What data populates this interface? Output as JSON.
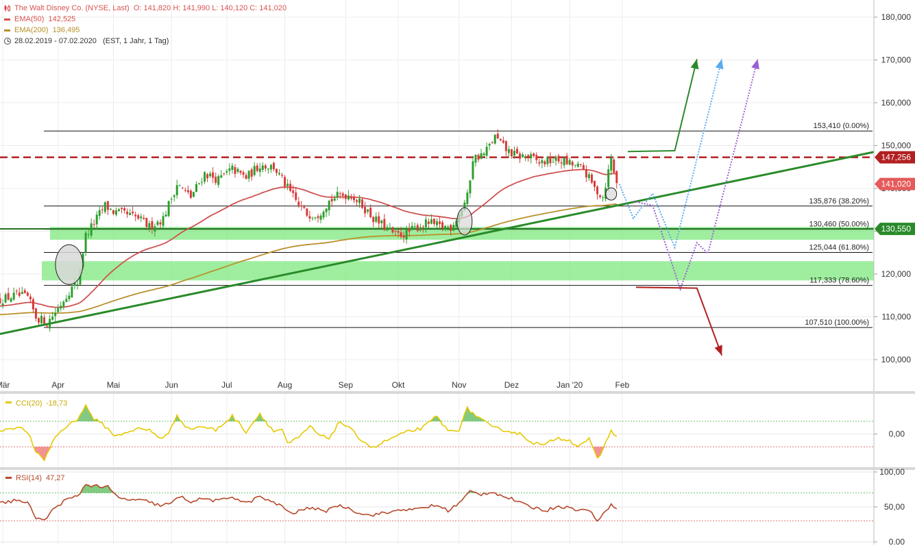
{
  "header": {
    "title": "The Walt Disney Co. (NYSE, Last)",
    "ohlc": "O: 141,820  H: 141,990  L: 140,120  C: 141,020",
    "ema50_label": "EMA(50)",
    "ema50_value": "142,525",
    "ema200_label": "EMA(200)",
    "ema200_value": "136,495",
    "date_range": "28.02.2019 - 07.02.2020",
    "range_info": "(EST, 1 Jahr, 1 Tag)"
  },
  "colors": {
    "up": "#2e9e2e",
    "down": "#d93a3a",
    "ema50": "#d05050",
    "ema200": "#b8902a",
    "trend": "#2a8a2a",
    "resistance": "#b22020",
    "zone": "#7fe87f",
    "cci": "#e6c800",
    "rsi": "#b5482a"
  },
  "chart_data": [
    {
      "type": "candlestick",
      "title": "The Walt Disney Co. (NYSE, Last)",
      "ylim": [
        96000,
        184000
      ],
      "y_ticks": [
        "180,000",
        "170,000",
        "160,000",
        "150,000",
        "140,000",
        "130,000",
        "120,000",
        "110,000",
        "100,000"
      ],
      "y_tick_values": [
        180000,
        170000,
        160000,
        150000,
        140000,
        130000,
        120000,
        110000,
        100000
      ],
      "x_ticks": [
        "Mär",
        "Apr",
        "Mai",
        "Jun",
        "Jul",
        "Aug",
        "Sep",
        "Okt",
        "Nov",
        "Dez",
        "Jan '20",
        "Feb"
      ],
      "x_tick_days": [
        3,
        23,
        43,
        64,
        84,
        105,
        127,
        146,
        168,
        187,
        208,
        227
      ],
      "day_range": [
        2,
        318
      ],
      "anchors": [
        [
          2,
          114
        ],
        [
          8,
          115
        ],
        [
          12,
          114.5
        ],
        [
          15,
          110
        ],
        [
          19,
          108.5
        ],
        [
          23,
          112
        ],
        [
          27,
          116
        ],
        [
          30,
          118
        ],
        [
          33,
          129
        ],
        [
          36,
          132
        ],
        [
          40,
          136
        ],
        [
          43,
          134.5
        ],
        [
          47,
          134
        ],
        [
          52,
          133
        ],
        [
          56,
          131
        ],
        [
          61,
          133
        ],
        [
          66,
          141
        ],
        [
          71,
          138
        ],
        [
          76,
          143.5
        ],
        [
          81,
          142
        ],
        [
          86,
          144.5
        ],
        [
          91,
          142.5
        ],
        [
          96,
          145.5
        ],
        [
          101,
          145
        ],
        [
          106,
          140
        ],
        [
          110,
          136
        ],
        [
          113,
          134
        ],
        [
          117,
          134
        ],
        [
          121,
          137
        ],
        [
          125,
          138.5
        ],
        [
          129,
          138.5
        ],
        [
          133,
          136
        ],
        [
          137,
          133
        ],
        [
          141,
          131
        ],
        [
          145,
          129
        ],
        [
          149,
          129.5
        ],
        [
          153,
          131
        ],
        [
          157,
          132
        ],
        [
          161,
          131
        ],
        [
          165,
          131
        ],
        [
          168,
          134
        ],
        [
          171,
          138
        ],
        [
          173,
          147
        ],
        [
          177,
          148
        ],
        [
          181,
          152
        ],
        [
          185,
          149
        ],
        [
          189,
          147.5
        ],
        [
          193,
          147.5
        ],
        [
          197,
          146
        ],
        [
          201,
          146.5
        ],
        [
          205,
          146.5
        ],
        [
          209,
          145.5
        ],
        [
          213,
          144.5
        ],
        [
          217,
          140
        ],
        [
          220,
          138
        ],
        [
          223,
          147
        ],
        [
          225,
          141
        ]
      ],
      "series": [
        {
          "name": "EMA(50)",
          "last": "142,525"
        },
        {
          "name": "EMA(200)",
          "last": "136,495"
        }
      ],
      "price_tags": [
        {
          "label": "147,256",
          "value": 147256,
          "color": "#b22020",
          "kind": "filled"
        },
        {
          "label": "141,020",
          "value": 141020,
          "color": "#e55a5a",
          "kind": "filled"
        },
        {
          "label": "130,550",
          "value": 130550,
          "color": "#2a8a2a",
          "kind": "filled"
        }
      ],
      "fib_levels": [
        {
          "label": "153,410 (0.00%)",
          "value": 153410
        },
        {
          "label": "135,876 (38.20%)",
          "value": 135876
        },
        {
          "label": "130,460 (50.00%)",
          "value": 130460
        },
        {
          "label": "125,044 (61.80%)",
          "value": 125044
        },
        {
          "label": "117,333 (78.60%)",
          "value": 117333
        },
        {
          "label": "107,510 (100.00%)",
          "value": 107510
        }
      ],
      "resistance": 147256,
      "support_line": 130550,
      "zones": [
        [
          128000,
          131000
        ],
        [
          118500,
          123000
        ]
      ],
      "trendline": [
        [
          2,
          106000
        ],
        [
          318,
          148500
        ]
      ],
      "scenarios": [
        {
          "style": "solid",
          "color": "#2a8a2a",
          "points": [
            [
              229,
              148600
            ],
            [
              246,
              148800
            ],
            [
              254,
              170200
            ]
          ]
        },
        {
          "style": "dotted",
          "color": "#5aaaf0",
          "points": [
            [
              226,
              141000
            ],
            [
              231,
              133000
            ],
            [
              238,
              138800
            ],
            [
              246,
              126200
            ],
            [
              263,
              170200
            ]
          ]
        },
        {
          "style": "dotted",
          "color": "#9a60d0",
          "points": [
            [
              231,
              137000
            ],
            [
              238,
              136000
            ],
            [
              248,
              116500
            ],
            [
              254,
              127300
            ],
            [
              258,
              124800
            ],
            [
              276,
              170200
            ]
          ]
        },
        {
          "style": "solid",
          "color": "#b22020",
          "points": [
            [
              232,
              116900
            ],
            [
              254,
              116700
            ],
            [
              263,
              101000
            ]
          ]
        }
      ]
    },
    {
      "type": "line",
      "title": "CCI(20)",
      "last": "-18,73",
      "ylim": [
        -260,
        310
      ],
      "y_ticks": [
        "0,00"
      ],
      "y_tick_values": [
        0
      ],
      "upper": 100,
      "lower": -100,
      "anchors": [
        [
          2,
          30
        ],
        [
          8,
          55
        ],
        [
          12,
          20
        ],
        [
          15,
          -150
        ],
        [
          18,
          -200
        ],
        [
          22,
          -20
        ],
        [
          26,
          60
        ],
        [
          30,
          120
        ],
        [
          33,
          220
        ],
        [
          36,
          120
        ],
        [
          40,
          60
        ],
        [
          44,
          -20
        ],
        [
          48,
          20
        ],
        [
          52,
          40
        ],
        [
          56,
          30
        ],
        [
          60,
          -30
        ],
        [
          63,
          0
        ],
        [
          66,
          150
        ],
        [
          70,
          40
        ],
        [
          75,
          60
        ],
        [
          80,
          30
        ],
        [
          86,
          140
        ],
        [
          91,
          20
        ],
        [
          96,
          160
        ],
        [
          101,
          20
        ],
        [
          104,
          40
        ],
        [
          106,
          -80
        ],
        [
          110,
          -30
        ],
        [
          114,
          60
        ],
        [
          118,
          -20
        ],
        [
          121,
          -30
        ],
        [
          125,
          100
        ],
        [
          129,
          30
        ],
        [
          133,
          -50
        ],
        [
          137,
          -110
        ],
        [
          141,
          -60
        ],
        [
          145,
          -20
        ],
        [
          150,
          20
        ],
        [
          155,
          50
        ],
        [
          160,
          140
        ],
        [
          164,
          20
        ],
        [
          168,
          40
        ],
        [
          171,
          200
        ],
        [
          175,
          130
        ],
        [
          180,
          50
        ],
        [
          185,
          30
        ],
        [
          190,
          0
        ],
        [
          195,
          -70
        ],
        [
          199,
          -90
        ],
        [
          203,
          -30
        ],
        [
          207,
          -40
        ],
        [
          211,
          -90
        ],
        [
          215,
          -40
        ],
        [
          218,
          -200
        ],
        [
          220,
          -120
        ],
        [
          223,
          30
        ],
        [
          225,
          -18.73
        ]
      ]
    },
    {
      "type": "line",
      "title": "RSI(14)",
      "last": "47,27",
      "ylim": [
        0,
        100
      ],
      "y_ticks": [
        "100,00",
        "50,00",
        "0,00"
      ],
      "y_tick_values": [
        100,
        50,
        0
      ],
      "upper": 70,
      "lower": 30,
      "anchors": [
        [
          2,
          55
        ],
        [
          8,
          60
        ],
        [
          12,
          55
        ],
        [
          15,
          35
        ],
        [
          18,
          30
        ],
        [
          22,
          50
        ],
        [
          26,
          60
        ],
        [
          30,
          65
        ],
        [
          33,
          82
        ],
        [
          37,
          80
        ],
        [
          41,
          78
        ],
        [
          45,
          62
        ],
        [
          50,
          60
        ],
        [
          55,
          58
        ],
        [
          60,
          52
        ],
        [
          64,
          55
        ],
        [
          67,
          65
        ],
        [
          71,
          58
        ],
        [
          76,
          62
        ],
        [
          81,
          58
        ],
        [
          86,
          65
        ],
        [
          91,
          55
        ],
        [
          96,
          65
        ],
        [
          101,
          55
        ],
        [
          104,
          52
        ],
        [
          107,
          40
        ],
        [
          111,
          45
        ],
        [
          115,
          50
        ],
        [
          119,
          42
        ],
        [
          123,
          52
        ],
        [
          127,
          50
        ],
        [
          131,
          43
        ],
        [
          135,
          38
        ],
        [
          139,
          40
        ],
        [
          143,
          42
        ],
        [
          147,
          47
        ],
        [
          151,
          45
        ],
        [
          156,
          50
        ],
        [
          160,
          52
        ],
        [
          164,
          45
        ],
        [
          168,
          55
        ],
        [
          172,
          72
        ],
        [
          176,
          68
        ],
        [
          180,
          72
        ],
        [
          184,
          65
        ],
        [
          188,
          60
        ],
        [
          192,
          52
        ],
        [
          196,
          48
        ],
        [
          200,
          45
        ],
        [
          204,
          52
        ],
        [
          208,
          48
        ],
        [
          212,
          46
        ],
        [
          216,
          43
        ],
        [
          218,
          30
        ],
        [
          220,
          38
        ],
        [
          223,
          55
        ],
        [
          225,
          47.27
        ]
      ]
    }
  ]
}
